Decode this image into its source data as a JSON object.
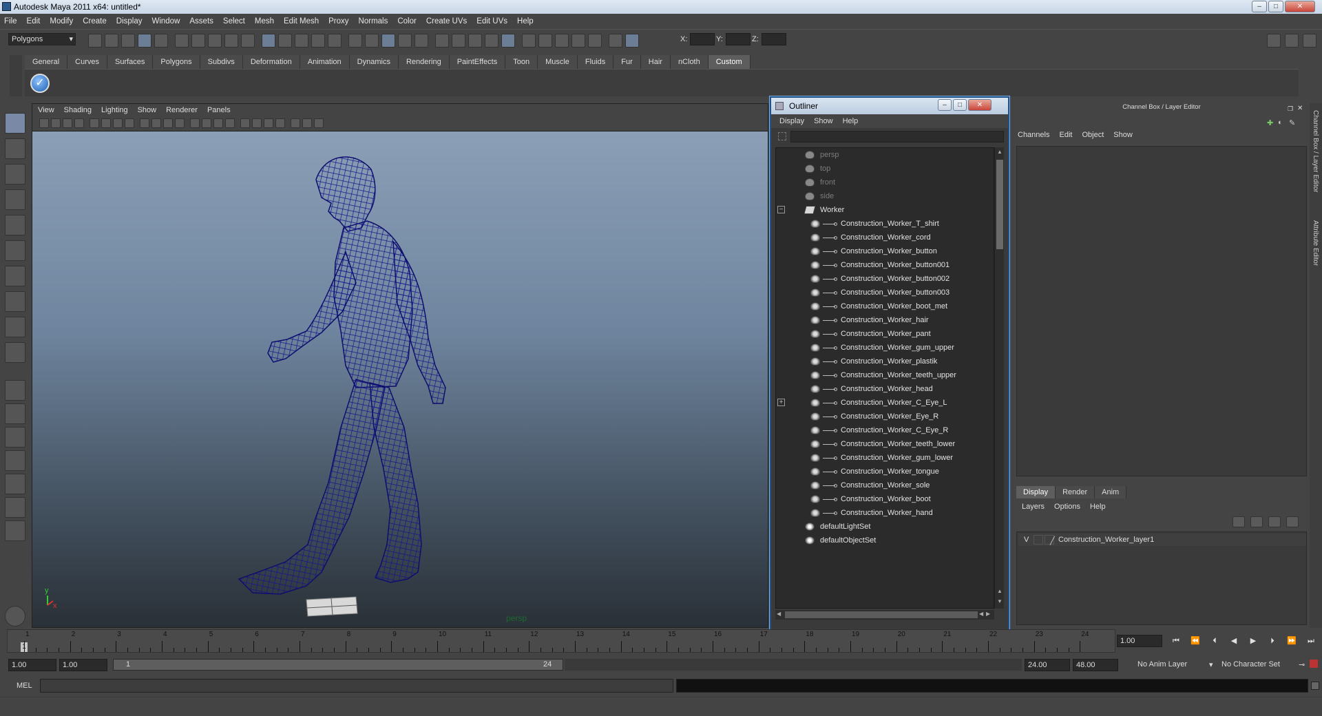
{
  "window": {
    "title": "Autodesk Maya 2011 x64: untitled*"
  },
  "menubar": [
    "File",
    "Edit",
    "Modify",
    "Create",
    "Display",
    "Window",
    "Assets",
    "Select",
    "Mesh",
    "Edit Mesh",
    "Proxy",
    "Normals",
    "Color",
    "Create UVs",
    "Edit UVs",
    "Help"
  ],
  "statusline": {
    "mode": "Polygons",
    "x_label": "X:",
    "y_label": "Y:",
    "z_label": "Z:"
  },
  "shelf_tabs": [
    {
      "label": "General",
      "active": false
    },
    {
      "label": "Curves",
      "active": false
    },
    {
      "label": "Surfaces",
      "active": false
    },
    {
      "label": "Polygons",
      "active": false
    },
    {
      "label": "Subdivs",
      "active": false
    },
    {
      "label": "Deformation",
      "active": false
    },
    {
      "label": "Animation",
      "active": false
    },
    {
      "label": "Dynamics",
      "active": false
    },
    {
      "label": "Rendering",
      "active": false
    },
    {
      "label": "PaintEffects",
      "active": false
    },
    {
      "label": "Toon",
      "active": false
    },
    {
      "label": "Muscle",
      "active": false
    },
    {
      "label": "Fluids",
      "active": false
    },
    {
      "label": "Fur",
      "active": false
    },
    {
      "label": "Hair",
      "active": false
    },
    {
      "label": "nCloth",
      "active": false
    },
    {
      "label": "Custom",
      "active": true
    }
  ],
  "viewport": {
    "menus": [
      "View",
      "Shading",
      "Lighting",
      "Show",
      "Renderer",
      "Panels"
    ],
    "camera_label": "persp",
    "axis_y": "y",
    "axis_x": "x"
  },
  "outliner": {
    "title": "Outliner",
    "menus": [
      "Display",
      "Show",
      "Help"
    ],
    "items": [
      {
        "label": "persp",
        "kind": "camera",
        "indent": 0
      },
      {
        "label": "top",
        "kind": "camera",
        "indent": 0
      },
      {
        "label": "front",
        "kind": "camera",
        "indent": 0
      },
      {
        "label": "side",
        "kind": "camera",
        "indent": 0
      },
      {
        "label": "Worker",
        "kind": "group",
        "indent": 0,
        "expand": "−"
      },
      {
        "label": "Construction_Worker_T_shirt",
        "kind": "mesh",
        "indent": 1
      },
      {
        "label": "Construction_Worker_cord",
        "kind": "mesh",
        "indent": 1
      },
      {
        "label": "Construction_Worker_button",
        "kind": "mesh",
        "indent": 1
      },
      {
        "label": "Construction_Worker_button001",
        "kind": "mesh",
        "indent": 1
      },
      {
        "label": "Construction_Worker_button002",
        "kind": "mesh",
        "indent": 1
      },
      {
        "label": "Construction_Worker_button003",
        "kind": "mesh",
        "indent": 1
      },
      {
        "label": "Construction_Worker_boot_met",
        "kind": "mesh",
        "indent": 1
      },
      {
        "label": "Construction_Worker_hair",
        "kind": "mesh",
        "indent": 1
      },
      {
        "label": "Construction_Worker_pant",
        "kind": "mesh",
        "indent": 1
      },
      {
        "label": "Construction_Worker_gum_upper",
        "kind": "mesh",
        "indent": 1
      },
      {
        "label": "Construction_Worker_plastik",
        "kind": "mesh",
        "indent": 1
      },
      {
        "label": "Construction_Worker_teeth_upper",
        "kind": "mesh",
        "indent": 1
      },
      {
        "label": "Construction_Worker_head",
        "kind": "mesh",
        "indent": 1
      },
      {
        "label": "Construction_Worker_C_Eye_L",
        "kind": "mesh",
        "indent": 1,
        "expand": "+"
      },
      {
        "label": "Construction_Worker_Eye_R",
        "kind": "mesh",
        "indent": 1
      },
      {
        "label": "Construction_Worker_C_Eye_R",
        "kind": "mesh",
        "indent": 1
      },
      {
        "label": "Construction_Worker_teeth_lower",
        "kind": "mesh",
        "indent": 1
      },
      {
        "label": "Construction_Worker_gum_lower",
        "kind": "mesh",
        "indent": 1
      },
      {
        "label": "Construction_Worker_tongue",
        "kind": "mesh",
        "indent": 1
      },
      {
        "label": "Construction_Worker_sole",
        "kind": "mesh",
        "indent": 1
      },
      {
        "label": "Construction_Worker_boot",
        "kind": "mesh",
        "indent": 1
      },
      {
        "label": "Construction_Worker_hand",
        "kind": "mesh",
        "indent": 1
      },
      {
        "label": "defaultLightSet",
        "kind": "set",
        "indent": 0
      },
      {
        "label": "defaultObjectSet",
        "kind": "set",
        "indent": 0
      }
    ]
  },
  "channelbox": {
    "title": "Channel Box / Layer Editor",
    "menus": [
      "Channels",
      "Edit",
      "Object",
      "Show"
    ],
    "layer_tabs": [
      {
        "label": "Display",
        "active": true
      },
      {
        "label": "Render",
        "active": false
      },
      {
        "label": "Anim",
        "active": false
      }
    ],
    "layer_menus": [
      "Layers",
      "Options",
      "Help"
    ],
    "layer": {
      "visible": "V",
      "name": "Construction_Worker_layer1"
    },
    "side_tabs": [
      "Channel Box / Layer Editor",
      "Attribute Editor"
    ]
  },
  "timeslider": {
    "ticks": [
      1,
      2,
      3,
      4,
      5,
      6,
      7,
      8,
      9,
      10,
      11,
      12,
      13,
      14,
      15,
      16,
      17,
      18,
      19,
      20,
      21,
      22,
      23,
      24
    ],
    "current": "1",
    "current_frame_field": "1.00"
  },
  "range": {
    "start": "1.00",
    "playback_start": "1.00",
    "slider_start": "1",
    "slider_end": "24",
    "playback_end": "24.00",
    "end": "48.00",
    "anim_layer": "No Anim Layer",
    "char_set": "No Character Set"
  },
  "cmdline": {
    "label": "MEL"
  },
  "colors": {
    "wireframe": "#1a1a8c",
    "selection_blue": "#1e5288"
  }
}
